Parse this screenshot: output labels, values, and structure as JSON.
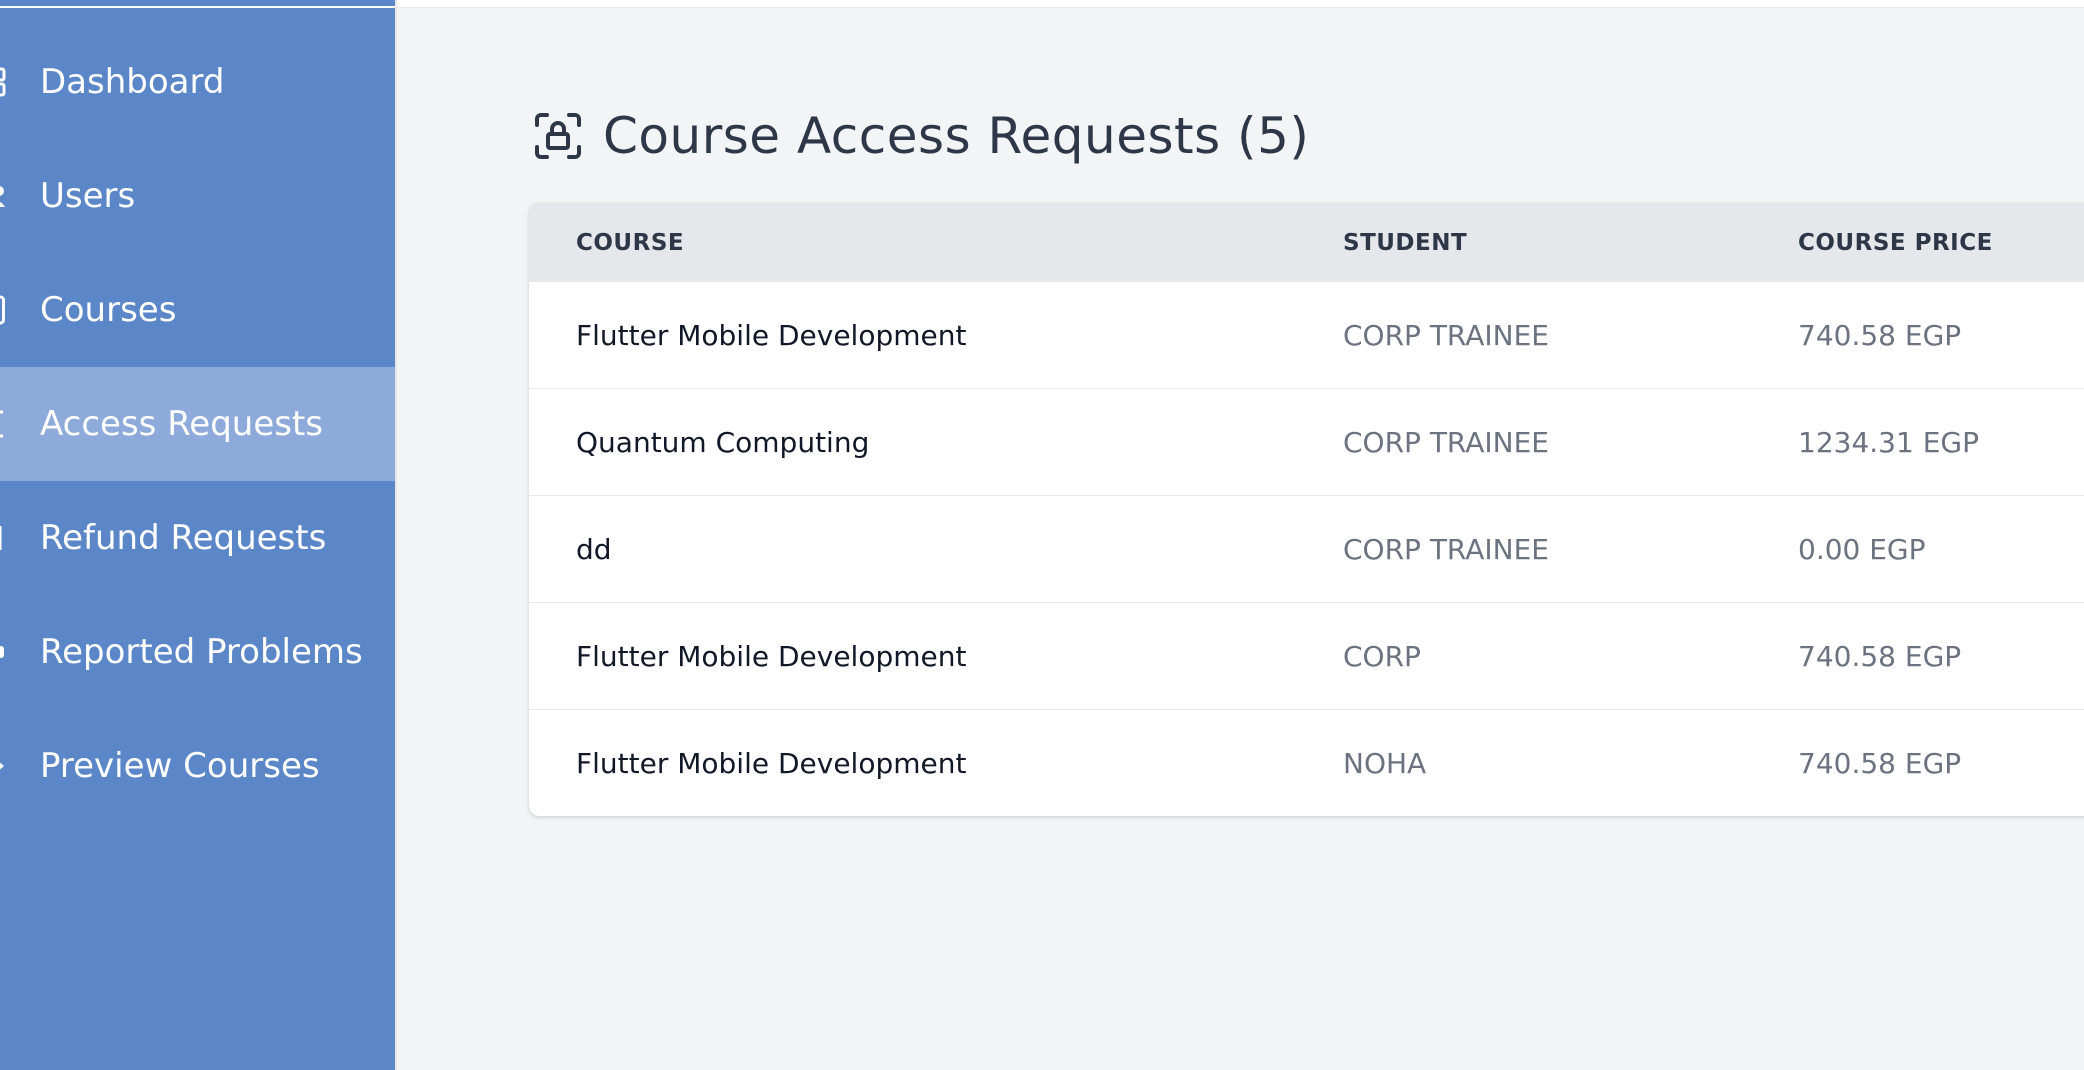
{
  "sidebar": {
    "items": [
      {
        "label": "Dashboard",
        "icon": "dashboard-icon",
        "active": false
      },
      {
        "label": "Users",
        "icon": "users-icon",
        "active": false
      },
      {
        "label": "Courses",
        "icon": "courses-icon",
        "active": false
      },
      {
        "label": "Access Requests",
        "icon": "access-requests-icon",
        "active": true
      },
      {
        "label": "Refund Requests",
        "icon": "refund-requests-icon",
        "active": false
      },
      {
        "label": "Reported Problems",
        "icon": "reported-problems-icon",
        "active": false
      },
      {
        "label": "Preview Courses",
        "icon": "preview-courses-icon",
        "active": false
      }
    ]
  },
  "page": {
    "title": "Course Access Requests (5)",
    "title_icon": "lock-scan-icon"
  },
  "table": {
    "headers": {
      "course": "COURSE",
      "student": "STUDENT",
      "price": "COURSE PRICE"
    },
    "rows": [
      {
        "course": "Flutter Mobile Development",
        "student": "CORP TRAINEE",
        "price": "740.58 EGP"
      },
      {
        "course": "Quantum Computing",
        "student": "CORP TRAINEE",
        "price": "1234.31 EGP"
      },
      {
        "course": "dd",
        "student": "CORP TRAINEE",
        "price": "0.00 EGP"
      },
      {
        "course": "Flutter Mobile Development",
        "student": "CORP",
        "price": "740.58 EGP"
      },
      {
        "course": "Flutter Mobile Development",
        "student": "NOHA",
        "price": "740.58 EGP"
      }
    ]
  },
  "colors": {
    "sidebar_bg": "#5b87c9",
    "sidebar_active_bg": "#8daadb",
    "page_bg": "#f3f4f6",
    "header_bg": "#e5e7eb",
    "title_text": "#2d3748",
    "muted_text": "#6b7280"
  }
}
